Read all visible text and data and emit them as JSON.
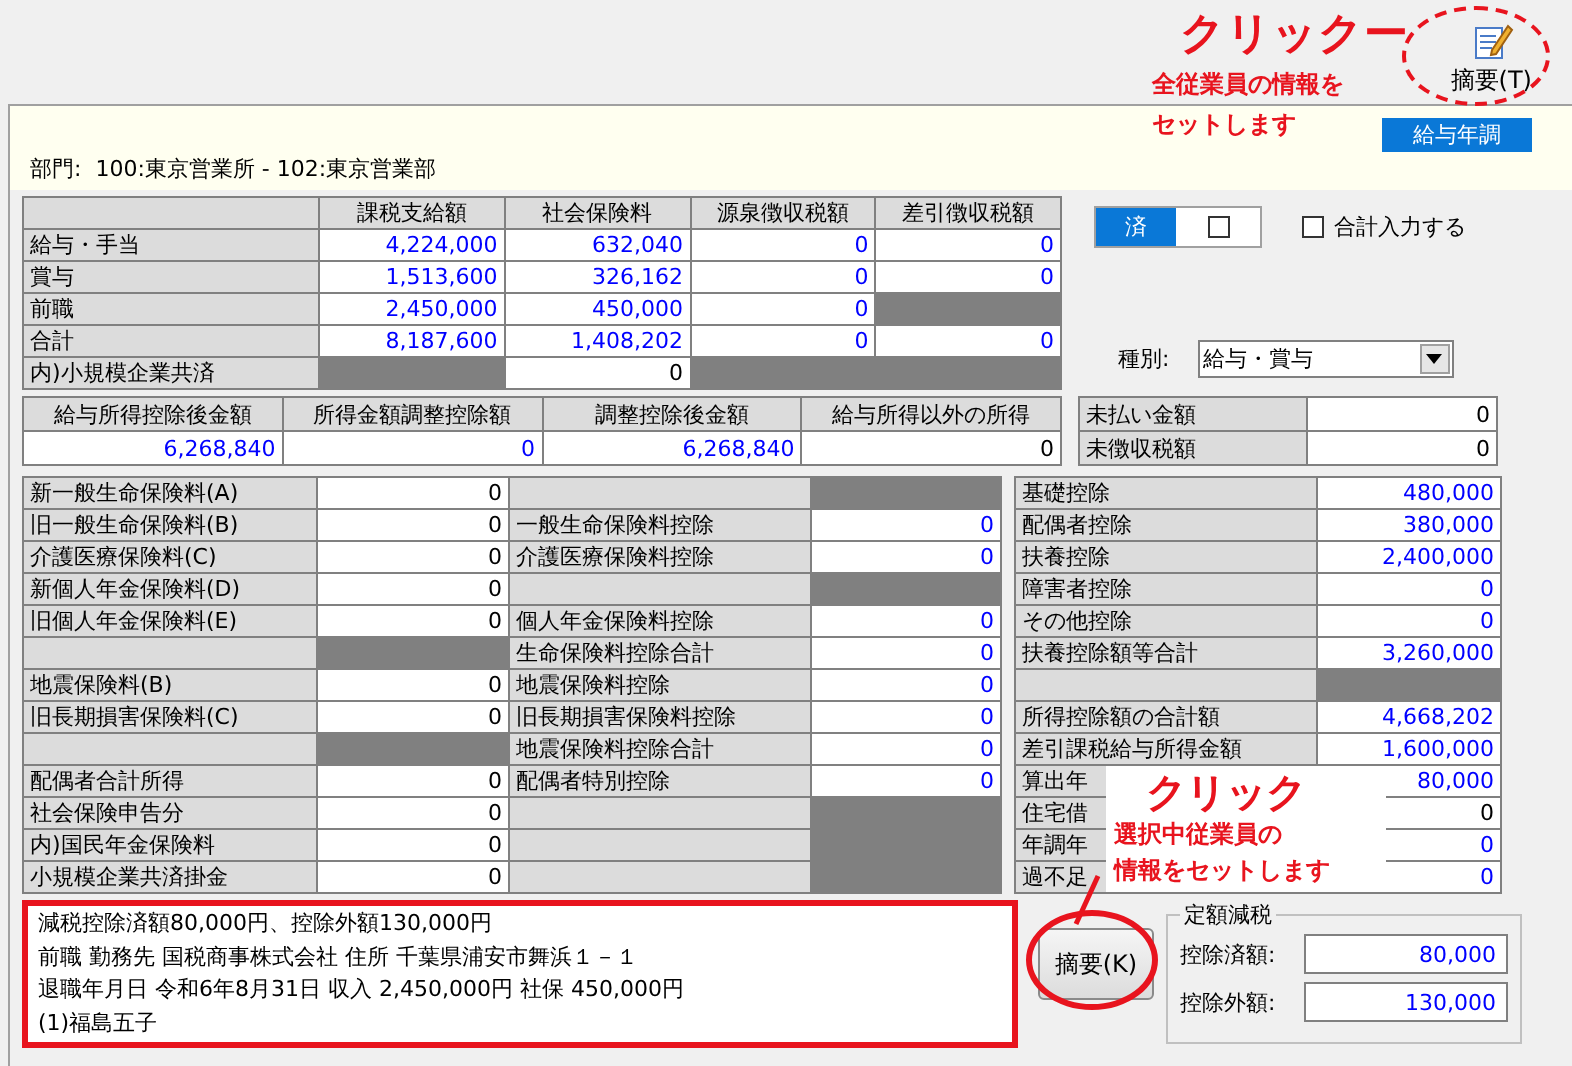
{
  "toolbar": {
    "summary_button": "摘要(T)"
  },
  "annotations": [
    {
      "kind": "top",
      "title": "クリックー",
      "lines": [
        "全従業員の情報を",
        "セットします"
      ]
    },
    {
      "kind": "callout",
      "title": "クリック",
      "lines": [
        "選択中従業員の",
        "情報をセットします"
      ]
    }
  ],
  "mode_label": "給与年調",
  "department": {
    "label": "部門:",
    "value": "100:東京営業所 - 102:東京営業部"
  },
  "pay_table": {
    "columns": [
      "課税支給額",
      "社会保険料",
      "源泉徴収税額",
      "差引徴収税額"
    ],
    "rows": [
      {
        "label": "給与・手当",
        "cells": [
          {
            "text": "4,224,000",
            "kind": "value"
          },
          {
            "text": "632,040",
            "kind": "value"
          },
          {
            "text": "0",
            "kind": "value"
          },
          {
            "text": "0",
            "kind": "value"
          }
        ]
      },
      {
        "label": "賞与",
        "cells": [
          {
            "text": "1,513,600",
            "kind": "value"
          },
          {
            "text": "326,162",
            "kind": "value"
          },
          {
            "text": "0",
            "kind": "value"
          },
          {
            "text": "0",
            "kind": "value"
          }
        ]
      },
      {
        "label": "前職",
        "cells": [
          {
            "text": "2,450,000",
            "kind": "value"
          },
          {
            "text": "450,000",
            "kind": "value"
          },
          {
            "text": "0",
            "kind": "value"
          },
          {
            "kind": "blocked"
          }
        ]
      },
      {
        "label": "合計",
        "cells": [
          {
            "text": "8,187,600",
            "kind": "value"
          },
          {
            "text": "1,408,202",
            "kind": "value"
          },
          {
            "text": "0",
            "kind": "value"
          },
          {
            "text": "0",
            "kind": "value"
          }
        ]
      },
      {
        "label": "内)小規模企業共済",
        "cells": [
          {
            "kind": "blocked"
          },
          {
            "text": "0",
            "kind": "plain"
          },
          {
            "kind": "blocked"
          },
          {
            "kind": "blocked"
          }
        ]
      }
    ]
  },
  "done_toggle": {
    "label": "済",
    "on": true,
    "checked": false
  },
  "total_input": {
    "label": "合計入力する",
    "checked": false
  },
  "type_select": {
    "label": "種別:",
    "value": "給与・賞与"
  },
  "income_table": {
    "columns": [
      "給与所得控除後金額",
      "所得金額調整控除額",
      "調整控除後金額",
      "給与所得以外の所得"
    ],
    "cells": [
      {
        "text": "6,268,840",
        "kind": "value"
      },
      {
        "text": "0",
        "kind": "value"
      },
      {
        "text": "6,268,840",
        "kind": "value"
      },
      {
        "text": "0",
        "kind": "plain"
      }
    ]
  },
  "unpaid_table": [
    {
      "label": "未払い金額",
      "value": "0"
    },
    {
      "label": "未徴収税額",
      "value": "0"
    }
  ],
  "insurance_table": [
    {
      "left": {
        "label": "新一般生命保険料(A)",
        "cell": {
          "text": "0",
          "kind": "plain"
        }
      },
      "right": {
        "cell": {
          "kind": "blocked"
        }
      }
    },
    {
      "left": {
        "label": "旧一般生命保険料(B)",
        "cell": {
          "text": "0",
          "kind": "plain"
        }
      },
      "right": {
        "label": "一般生命保険料控除",
        "cell": {
          "text": "0",
          "kind": "value"
        }
      }
    },
    {
      "left": {
        "label": "介護医療保険料(C)",
        "cell": {
          "text": "0",
          "kind": "plain"
        }
      },
      "right": {
        "label": "介護医療保険料控除",
        "cell": {
          "text": "0",
          "kind": "value"
        }
      }
    },
    {
      "left": {
        "label": "新個人年金保険料(D)",
        "cell": {
          "text": "0",
          "kind": "plain"
        }
      },
      "right": {
        "cell": {
          "kind": "blocked"
        }
      }
    },
    {
      "left": {
        "label": "旧個人年金保険料(E)",
        "cell": {
          "text": "0",
          "kind": "plain"
        }
      },
      "right": {
        "label": "個人年金保険料控除",
        "cell": {
          "text": "0",
          "kind": "value"
        }
      }
    },
    {
      "left": {
        "cell": {
          "kind": "blocked"
        }
      },
      "right": {
        "label": "生命保険料控除合計",
        "cell": {
          "text": "0",
          "kind": "value"
        }
      }
    },
    {
      "left": {
        "label": "地震保険料(B)",
        "cell": {
          "text": "0",
          "kind": "plain"
        }
      },
      "right": {
        "label": "地震保険料控除",
        "cell": {
          "text": "0",
          "kind": "value"
        }
      }
    },
    {
      "left": {
        "label": "旧長期損害保険料(C)",
        "cell": {
          "text": "0",
          "kind": "plain"
        }
      },
      "right": {
        "label": "旧長期損害保険料控除",
        "cell": {
          "text": "0",
          "kind": "value"
        }
      }
    },
    {
      "left": {
        "cell": {
          "kind": "blocked"
        }
      },
      "right": {
        "label": "地震保険料控除合計",
        "cell": {
          "text": "0",
          "kind": "value"
        }
      }
    },
    {
      "left": {
        "label": "配偶者合計所得",
        "cell": {
          "text": "0",
          "kind": "plain"
        }
      },
      "right": {
        "label": "配偶者特別控除",
        "cell": {
          "text": "0",
          "kind": "value"
        }
      }
    },
    {
      "left": {
        "label": "社会保険申告分",
        "cell": {
          "text": "0",
          "kind": "plain"
        }
      },
      "right": {
        "cell": {
          "kind": "blocked"
        }
      }
    },
    {
      "left": {
        "label": "内)国民年金保険料",
        "cell": {
          "text": "0",
          "kind": "plain"
        }
      },
      "right": {
        "cell": {
          "kind": "blocked"
        }
      }
    },
    {
      "left": {
        "label": "小規模企業共済掛金",
        "cell": {
          "text": "0",
          "kind": "plain"
        }
      },
      "right": {
        "cell": {
          "kind": "blocked"
        }
      }
    }
  ],
  "deduction_table": [
    {
      "label": "基礎控除",
      "cell": {
        "text": "480,000",
        "kind": "value"
      }
    },
    {
      "label": "配偶者控除",
      "cell": {
        "text": "380,000",
        "kind": "value"
      }
    },
    {
      "label": "扶養控除",
      "cell": {
        "text": "2,400,000",
        "kind": "value"
      }
    },
    {
      "label": "障害者控除",
      "cell": {
        "text": "0",
        "kind": "value"
      }
    },
    {
      "label": "その他控除",
      "cell": {
        "text": "0",
        "kind": "value"
      }
    },
    {
      "label": "扶養控除額等合計",
      "cell": {
        "text": "3,260,000",
        "kind": "value"
      }
    },
    {
      "cell": {
        "kind": "blocked"
      }
    },
    {
      "label": "所得控除額の合計額",
      "cell": {
        "text": "4,668,202",
        "kind": "value"
      }
    },
    {
      "label": "差引課税給与所得金額",
      "cell": {
        "text": "1,600,000",
        "kind": "value"
      }
    },
    {
      "label": "算出年",
      "cell": {
        "text": "80,000",
        "kind": "value"
      }
    },
    {
      "label": "住宅借",
      "cell": {
        "text": "0",
        "kind": "plain"
      }
    },
    {
      "label": "年調年",
      "cell": {
        "text": "0",
        "kind": "value"
      }
    },
    {
      "label": "過不足",
      "cell": {
        "text": "0",
        "kind": "value"
      }
    }
  ],
  "memo": [
    "減税控除済額80,000円、控除外額130,000円",
    "前職 勤務先 国税商事株式会社 住所 千葉県浦安市舞浜１－１",
    "退職年月日 令和6年8月31日 収入 2,450,000円 社保 450,000円",
    "(1)福島五子"
  ],
  "summary_button": "摘要(K)",
  "fixed_tax_cut": {
    "title": "定額減税",
    "fields": [
      {
        "label": "控除済額:",
        "value": "80,000"
      },
      {
        "label": "控除外額:",
        "value": "130,000"
      }
    ]
  }
}
